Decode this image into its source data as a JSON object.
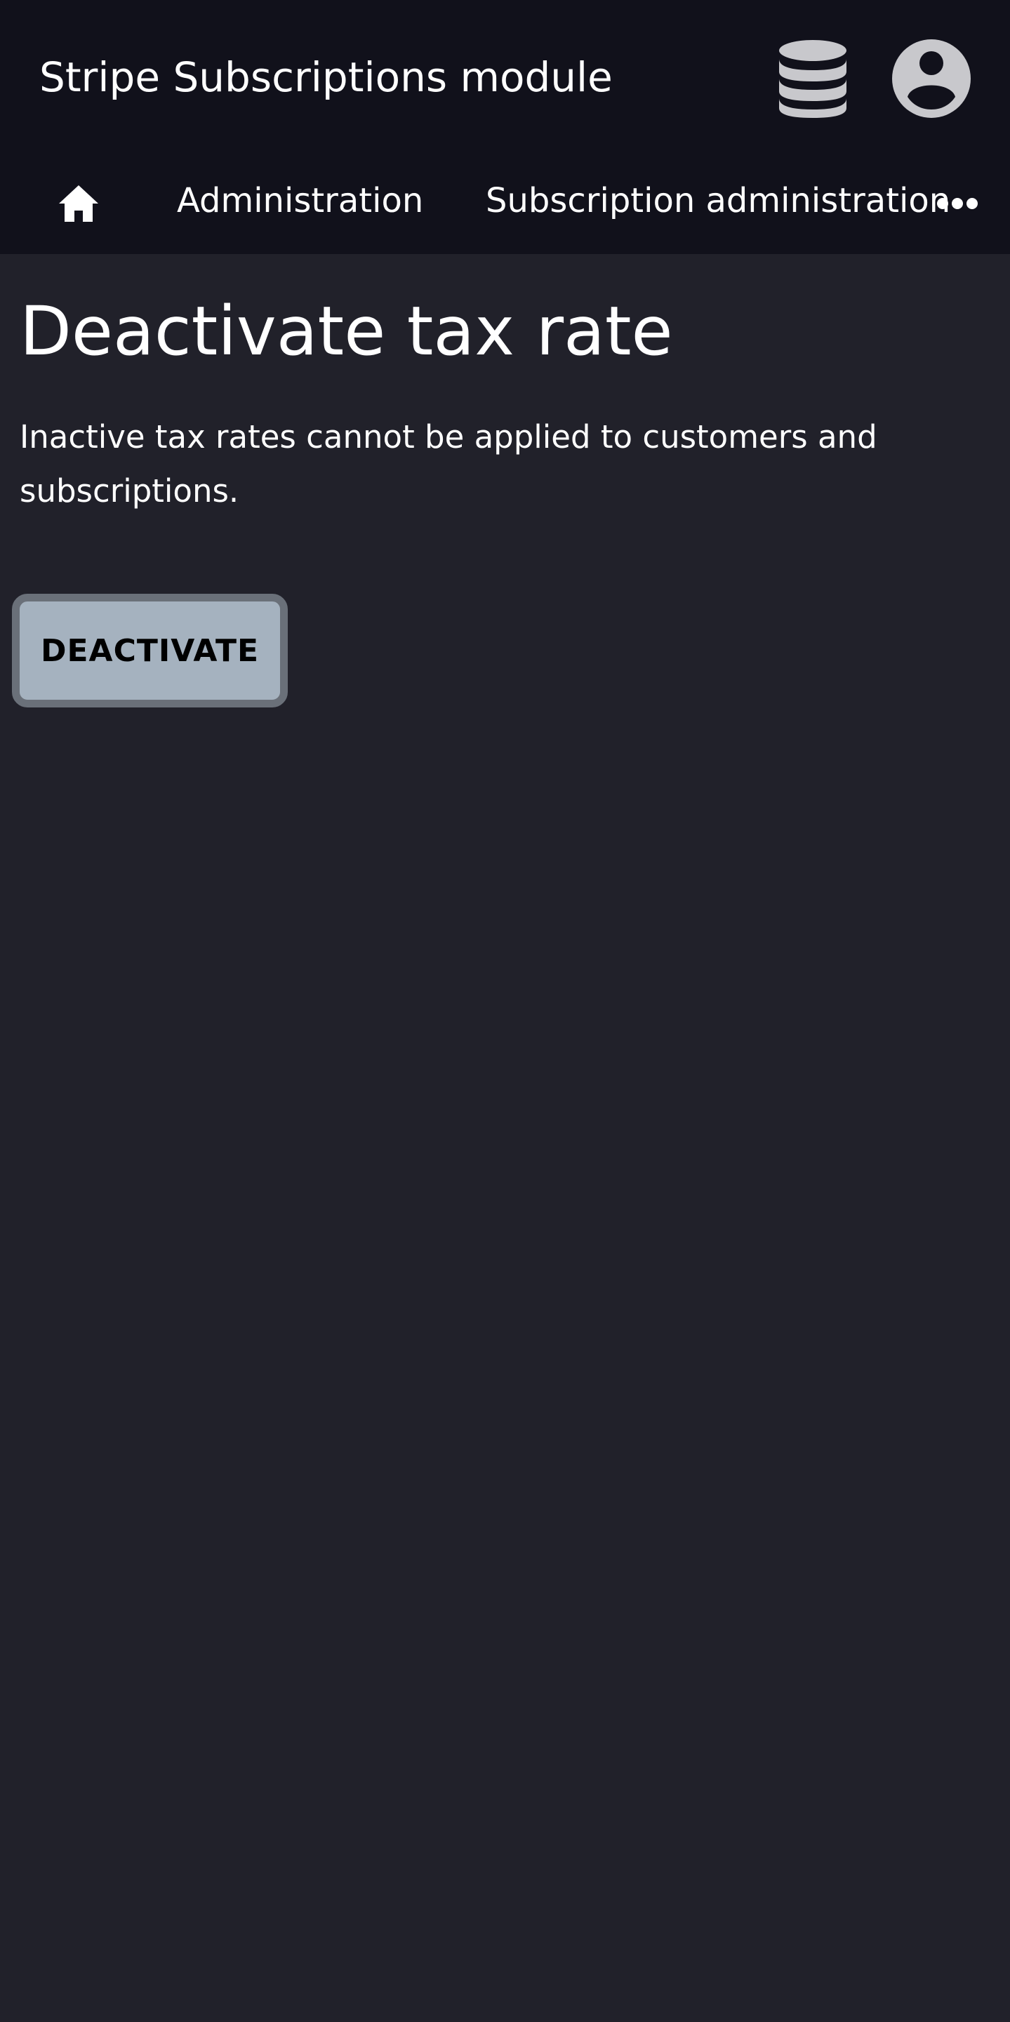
{
  "app": {
    "title": "Stripe Subscriptions module"
  },
  "header": {
    "icons": [
      "database-icon",
      "account-circle-icon"
    ],
    "colors": {
      "background": "#11111b",
      "icon": "#c8c8cc"
    }
  },
  "breadcrumb": {
    "home_icon": "home-icon",
    "items": [
      {
        "label": "Administration"
      },
      {
        "label": "Subscription administration"
      }
    ],
    "more_icon": "more-horizontal-icon"
  },
  "main": {
    "title": "Deactivate tax rate",
    "description": "Inactive tax rates cannot be applied to customers and subscriptions.",
    "button_label": "DEACTIVATE",
    "colors": {
      "background": "#21212a",
      "button": "#a5b2bf",
      "button_border": "#6a7079"
    }
  }
}
